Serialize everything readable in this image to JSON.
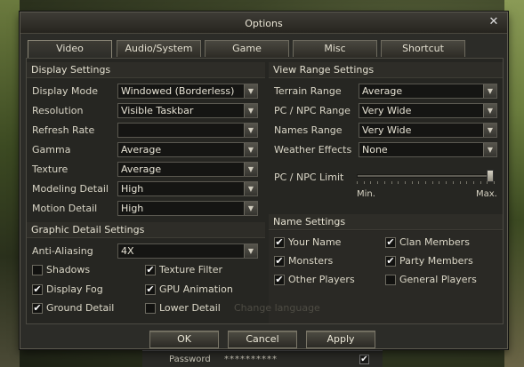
{
  "window": {
    "title": "Options"
  },
  "tabs": [
    "Video",
    "Audio/System",
    "Game",
    "Misc",
    "Shortcut"
  ],
  "display": {
    "title": "Display Settings",
    "rows": [
      {
        "label": "Display Mode",
        "value": "Windowed (Borderless)"
      },
      {
        "label": "Resolution",
        "value": "Visible Taskbar"
      },
      {
        "label": "Refresh Rate",
        "value": ""
      },
      {
        "label": "Gamma",
        "value": "Average"
      },
      {
        "label": "Texture",
        "value": "Average"
      },
      {
        "label": "Modeling Detail",
        "value": "High"
      },
      {
        "label": "Motion Detail",
        "value": "High"
      }
    ]
  },
  "graphic": {
    "title": "Graphic Detail Settings",
    "aa_label": "Anti-Aliasing",
    "aa_value": "4X",
    "checks": [
      {
        "label": "Shadows",
        "checked": false
      },
      {
        "label": "Texture Filter",
        "checked": true
      },
      {
        "label": "Display Fog",
        "checked": true
      },
      {
        "label": "GPU Animation",
        "checked": true
      },
      {
        "label": "Ground Detail",
        "checked": true
      },
      {
        "label": "Lower Detail",
        "checked": false
      }
    ]
  },
  "view_range": {
    "title": "View Range Settings",
    "rows": [
      {
        "label": "Terrain Range",
        "value": "Average"
      },
      {
        "label": "PC / NPC Range",
        "value": "Very Wide"
      },
      {
        "label": "Names Range",
        "value": "Very Wide"
      },
      {
        "label": "Weather Effects",
        "value": "None"
      }
    ],
    "limit_label": "PC / NPC Limit",
    "limit_min": "Min.",
    "limit_max": "Max.",
    "limit_level": 1.0
  },
  "names": {
    "title": "Name Settings",
    "checks": [
      {
        "label": "Your Name",
        "checked": true
      },
      {
        "label": "Clan Members",
        "checked": true
      },
      {
        "label": "Monsters",
        "checked": true
      },
      {
        "label": "Party Members",
        "checked": true
      },
      {
        "label": "Other Players",
        "checked": true
      },
      {
        "label": "General Players",
        "checked": false
      }
    ]
  },
  "ghost_text": "Change language",
  "buttons": {
    "ok": "OK",
    "cancel": "Cancel",
    "apply": "Apply"
  },
  "background": {
    "password_label": "Password",
    "password_value": "**********"
  },
  "icons": {
    "close": "close-icon",
    "dropdown": "chevron-down-icon",
    "check": "checkmark-icon"
  }
}
